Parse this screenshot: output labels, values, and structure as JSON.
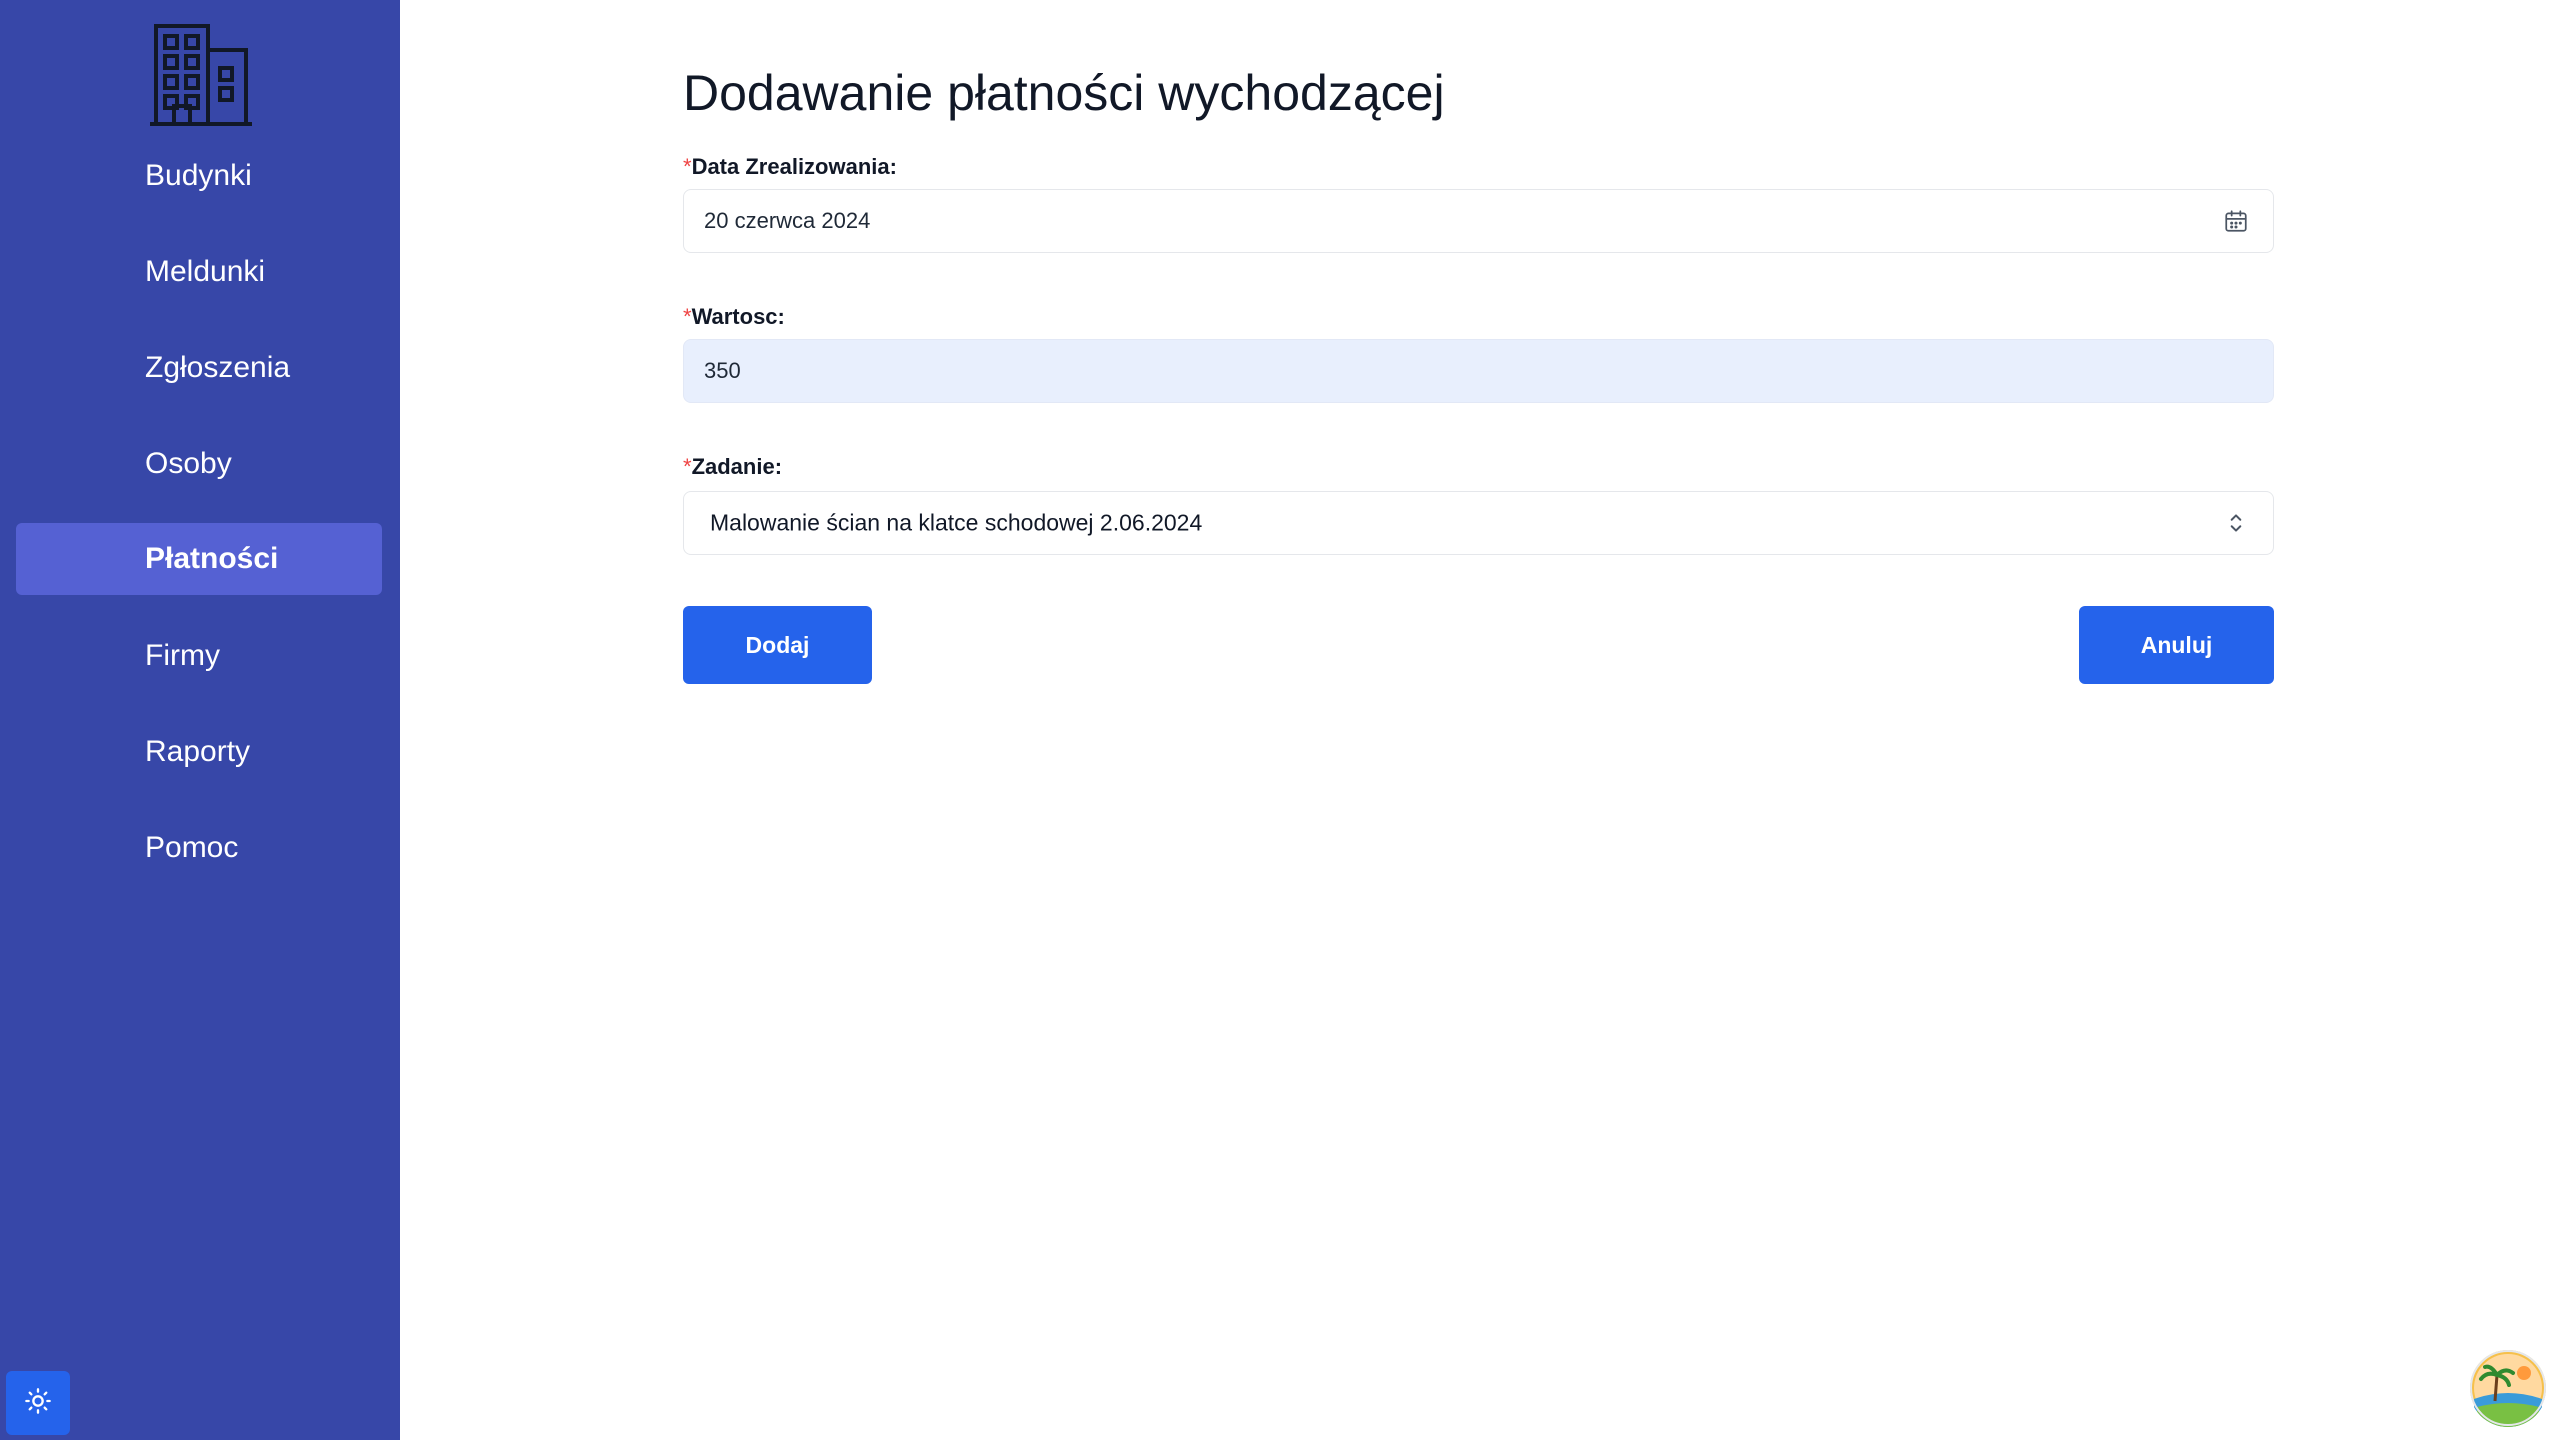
{
  "sidebar": {
    "logo_icon": "office-building-icon",
    "items": [
      {
        "label": "Budynki",
        "active": false
      },
      {
        "label": "Meldunki",
        "active": false
      },
      {
        "label": "Zgłoszenia",
        "active": false
      },
      {
        "label": "Osoby",
        "active": false
      },
      {
        "label": "Płatności",
        "active": true
      },
      {
        "label": "Firmy",
        "active": false
      },
      {
        "label": "Raporty",
        "active": false
      },
      {
        "label": "Pomoc",
        "active": false
      }
    ],
    "theme_toggle_icon": "sun-icon"
  },
  "page": {
    "title": "Dodawanie płatności wychodzącej"
  },
  "form": {
    "required_mark": "*",
    "date": {
      "label": "Data Zrealizowania:",
      "value": "20 czerwca 2024",
      "icon": "calendar-icon"
    },
    "amount": {
      "label": "Wartosc:",
      "value": "350"
    },
    "task": {
      "label": "Zadanie:",
      "value": "Malowanie ścian na klatce schodowej 2.06.2024",
      "icon": "chevron-up-down-icon"
    },
    "add_label": "Dodaj",
    "cancel_label": "Anuluj"
  },
  "colors": {
    "sidebar_bg": "#3747a8",
    "sidebar_active": "#5561d3",
    "primary": "#2563eb",
    "required": "#ef4444",
    "filled_input": "#e8effd"
  }
}
